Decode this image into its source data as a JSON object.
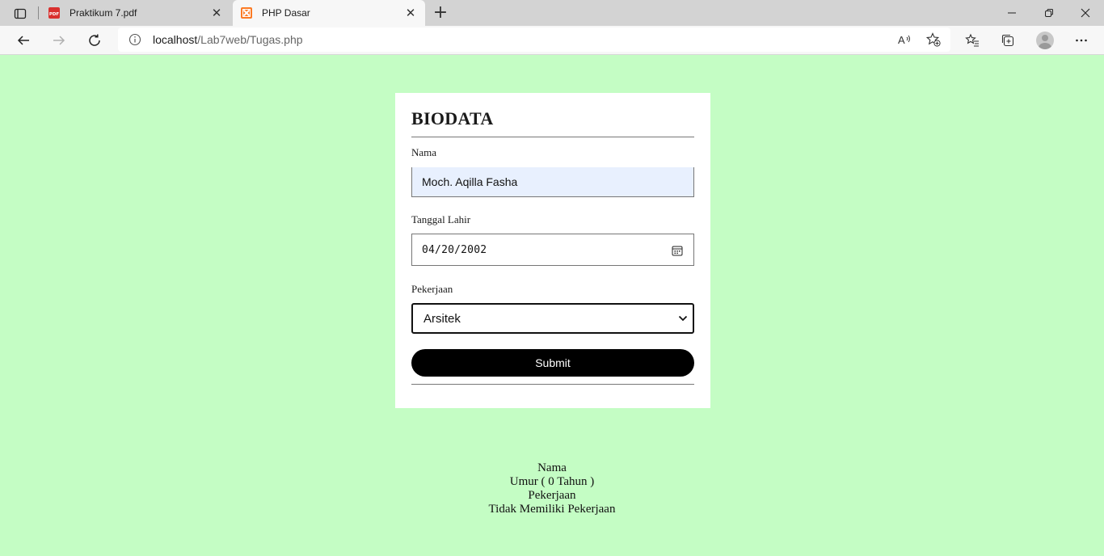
{
  "browser": {
    "tabs": [
      {
        "title": "Praktikum 7.pdf",
        "icon": "pdf-icon"
      },
      {
        "title": "PHP Dasar",
        "icon": "xampp-icon"
      }
    ],
    "address": {
      "host": "localhost",
      "path": "/Lab7web/Tugas.php"
    }
  },
  "form": {
    "heading": "BIODATA",
    "name_label": "Nama",
    "name_value": "Moch. Aqilla Fasha",
    "dob_label": "Tanggal Lahir",
    "dob_value": "04/20/2002",
    "job_label": "Pekerjaan",
    "job_value": "Arsitek",
    "submit_label": "Submit"
  },
  "result": {
    "line1": "Nama",
    "line2": "Umur ( 0 Tahun )",
    "line3": "Pekerjaan",
    "line4": "Tidak Memiliki Pekerjaan"
  },
  "colors": {
    "page_background": "#c4fdc4",
    "card_background": "#ffffff",
    "button": "#000000"
  }
}
